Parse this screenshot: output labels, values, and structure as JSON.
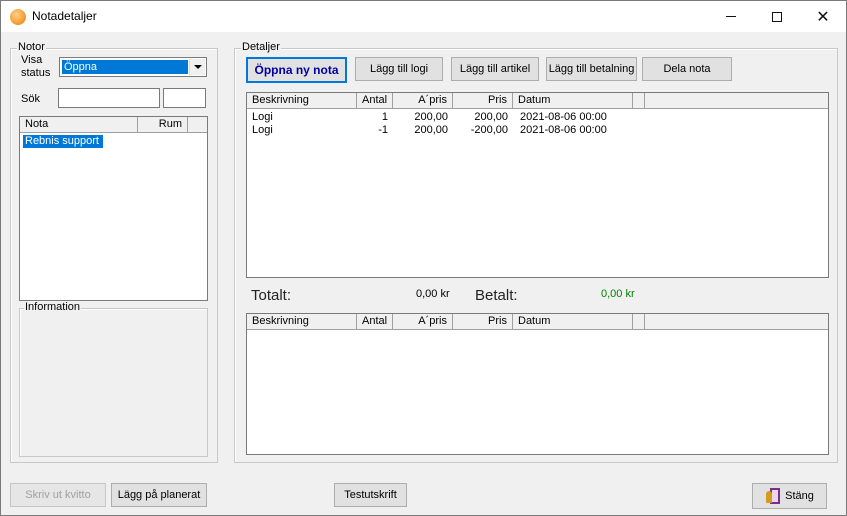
{
  "window": {
    "title": "Notadetaljer"
  },
  "notor": {
    "legend": "Notor",
    "visa_status_label_line1": "Visa",
    "visa_status_label_line2": "status",
    "visa_status_value": "Öppna",
    "sok_label": "Sök",
    "sok_value": "",
    "sok_value2": "",
    "list_columns": [
      "Nota",
      "Rum"
    ],
    "list_items": [
      {
        "nota": "Rebnis support",
        "rum": ""
      }
    ],
    "information_legend": "Information"
  },
  "detaljer": {
    "legend": "Detaljer",
    "toolbar": {
      "open_new": "Öppna ny nota",
      "add_logi": "Lägg till logi",
      "add_artikel": "Lägg till artikel",
      "add_betalning": "Lägg till betalning",
      "dela_nota": "Dela nota"
    },
    "columns": [
      "Beskrivning",
      "Antal",
      "A´pris",
      "Pris",
      "Datum"
    ],
    "rows": [
      {
        "beskrivning": "Logi",
        "antal": "1",
        "apris": "200,00",
        "pris": "200,00",
        "datum": "2021-08-06 00:00"
      },
      {
        "beskrivning": "Logi",
        "antal": "-1",
        "apris": "200,00",
        "pris": "-200,00",
        "datum": "2021-08-06 00:00"
      }
    ],
    "totalt_label": "Totalt:",
    "totalt_value": "0,00 kr",
    "betalt_label": "Betalt:",
    "betalt_value": "0,00 kr",
    "payments_columns": [
      "Beskrivning",
      "Antal",
      "A´pris",
      "Pris",
      "Datum"
    ],
    "payments_rows": []
  },
  "footer": {
    "skriv_ut_kvitto": "Skriv ut kvitto",
    "lagg_pa_planerat": "Lägg på planerat",
    "testutskrift": "Testutskrift",
    "stang": "Stäng"
  },
  "colors": {
    "selection": "#0078d7",
    "paid_green": "#008000",
    "primary_text": "#0000a0"
  }
}
